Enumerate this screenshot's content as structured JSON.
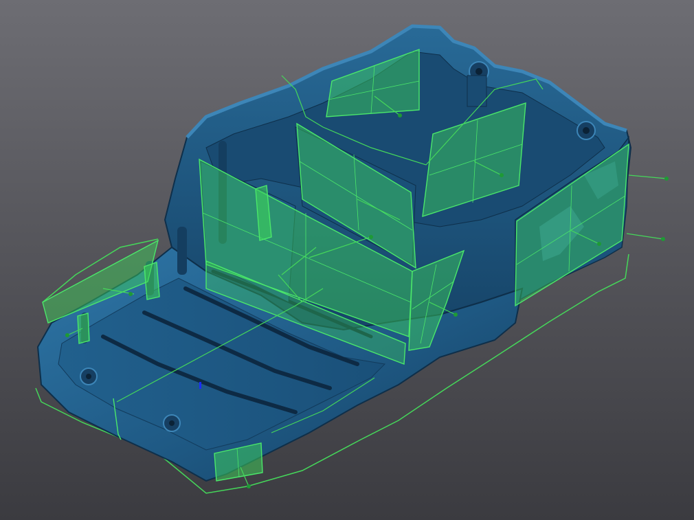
{
  "viewport": {
    "background_top": "#6d6d73",
    "background_bottom": "#3b3b40"
  },
  "part": {
    "body_color": "#1f5a85",
    "shadow_color": "#0e2f4a",
    "highlight_color": "#3d86b8",
    "rim_color": "#2a6e9c"
  },
  "overlay": {
    "plane_fill": "#3ed65a",
    "plane_stroke": "#4be86a",
    "outline_color": "#45d85a",
    "marker_color": "#1e9a35",
    "origin_marker_color": "#1a2cff"
  },
  "icons": {
    "fixture": "mounting-boss-icon",
    "origin": "coordinate-origin-icon"
  }
}
